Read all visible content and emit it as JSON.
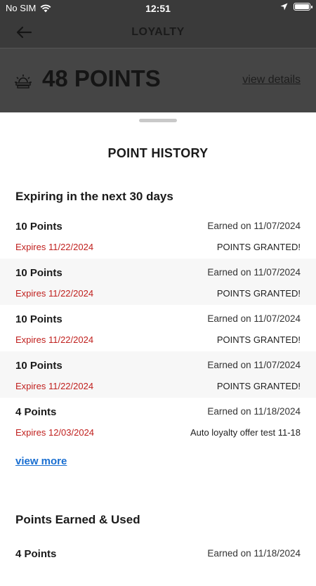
{
  "status_bar": {
    "carrier": "No SIM",
    "time": "12:51"
  },
  "nav": {
    "title": "LOYALTY"
  },
  "points_summary": {
    "value": "48 POINTS",
    "details_link": "view details"
  },
  "sheet": {
    "title": "POINT HISTORY",
    "expiring_section": {
      "title": "Expiring in the next 30 days",
      "items": [
        {
          "points": "10 Points",
          "earned": "Earned on 11/07/2024",
          "expires": "Expires 11/22/2024",
          "status": "POINTS GRANTED!"
        },
        {
          "points": "10 Points",
          "earned": "Earned on 11/07/2024",
          "expires": "Expires 11/22/2024",
          "status": "POINTS GRANTED!"
        },
        {
          "points": "10 Points",
          "earned": "Earned on 11/07/2024",
          "expires": "Expires 11/22/2024",
          "status": "POINTS GRANTED!"
        },
        {
          "points": "10 Points",
          "earned": "Earned on 11/07/2024",
          "expires": "Expires 11/22/2024",
          "status": "POINTS GRANTED!"
        },
        {
          "points": "4 Points",
          "earned": "Earned on 11/18/2024",
          "expires": "Expires 12/03/2024",
          "status": "Auto loyalty offer test 11-18"
        }
      ],
      "view_more": "view more"
    },
    "earned_used_section": {
      "title": "Points Earned & Used",
      "items": [
        {
          "points": "4 Points",
          "earned": "Earned on 11/18/2024"
        }
      ]
    }
  }
}
